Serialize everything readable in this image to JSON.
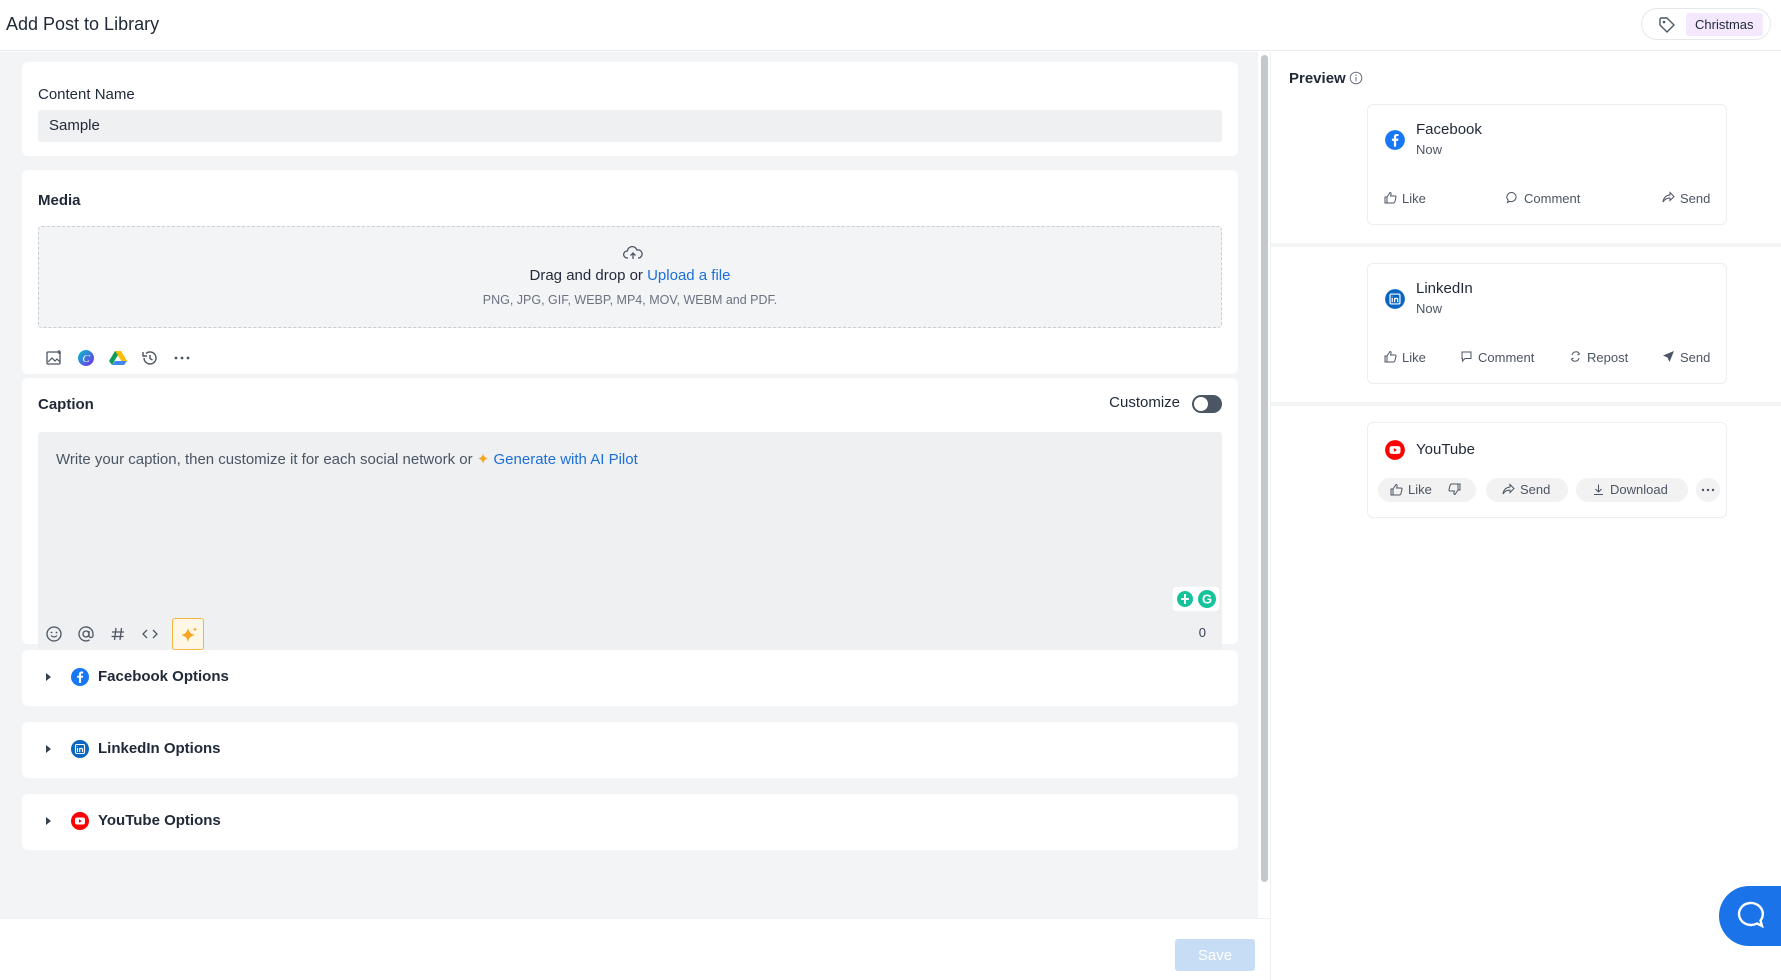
{
  "header": {
    "title": "Add Post to Library",
    "tag_label": "Christmas"
  },
  "content_name": {
    "label": "Content Name",
    "value": "Sample"
  },
  "media": {
    "label": "Media",
    "drag_text": "Drag and drop or",
    "upload_link": "Upload a file",
    "formats": "PNG, JPG, GIF, WEBP, MP4, MOV, WEBM and PDF.",
    "tools": [
      "image-icon",
      "canva-icon",
      "google-drive-icon",
      "history-icon",
      "more-icon"
    ]
  },
  "caption": {
    "label": "Caption",
    "customize_label": "Customize",
    "customize_on": false,
    "placeholder": "Write your caption, then customize it for each social network or",
    "ai_link": "Generate with AI Pilot",
    "char_count": "0",
    "tools": [
      "emoji-icon",
      "mention-icon",
      "hashtag-icon",
      "code-icon",
      "ai-sparkle-icon"
    ]
  },
  "options": [
    {
      "label": "Facebook Options",
      "icon": "facebook-icon"
    },
    {
      "label": "LinkedIn Options",
      "icon": "linkedin-icon"
    },
    {
      "label": "YouTube Options",
      "icon": "youtube-icon"
    }
  ],
  "footer": {
    "save_label": "Save"
  },
  "preview": {
    "title": "Preview",
    "facebook": {
      "name": "Facebook",
      "time": "Now",
      "actions": [
        "Like",
        "Comment",
        "Send"
      ]
    },
    "linkedin": {
      "name": "LinkedIn",
      "time": "Now",
      "actions": [
        "Like",
        "Comment",
        "Repost",
        "Send"
      ]
    },
    "youtube": {
      "name": "YouTube",
      "actions": [
        "Like",
        "Send",
        "Download"
      ]
    }
  },
  "colors": {
    "accent": "#1d6fd8",
    "facebook": "#1877f2",
    "linkedin": "#0a66c2",
    "youtube": "#ff0000",
    "tag_bg": "#f3e8fd",
    "save_disabled": "#c7dcf5"
  }
}
